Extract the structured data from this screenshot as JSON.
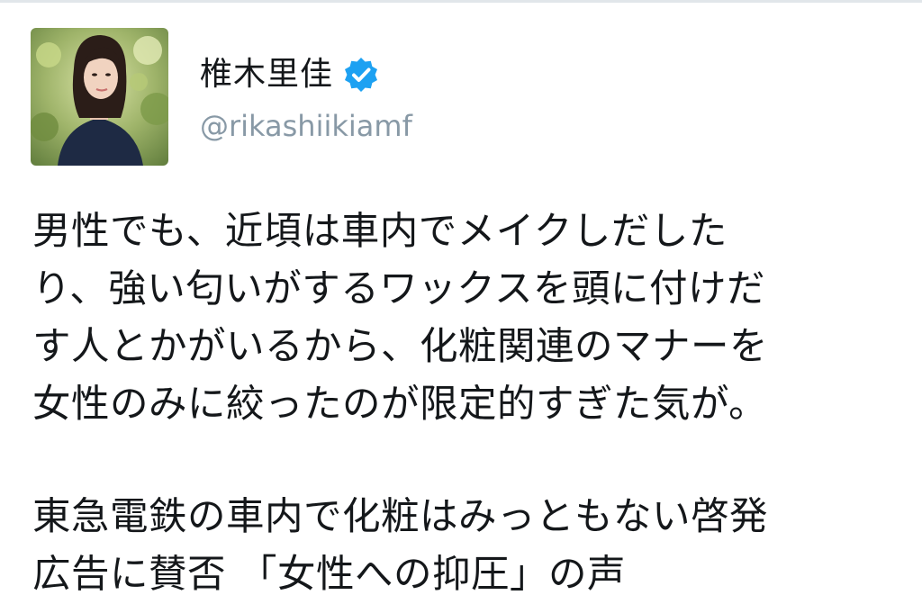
{
  "profile": {
    "display_name": "椎木里佳",
    "handle": "@rikashiikiamf",
    "verified": true,
    "avatar_icon": "profile-photo",
    "badge_icon": "verified-badge-icon",
    "badge_color": "#1da1f2"
  },
  "tweet": {
    "paragraph1": [
      "男性でも、近頃は車内でメイクしだした",
      "り、強い匂いがするワックスを頭に付けだ",
      "す人とかがいるから、化粧関連のマナーを",
      "女性のみに絞ったのが限定的すぎた気が。"
    ],
    "paragraph2": [
      "東急電鉄の車内で化粧はみっともない啓発",
      "広告に賛否 「女性への抑圧」の声"
    ]
  },
  "colors": {
    "text": "#14171a",
    "secondary": "#8899a6",
    "divider": "#e1e6ea"
  }
}
